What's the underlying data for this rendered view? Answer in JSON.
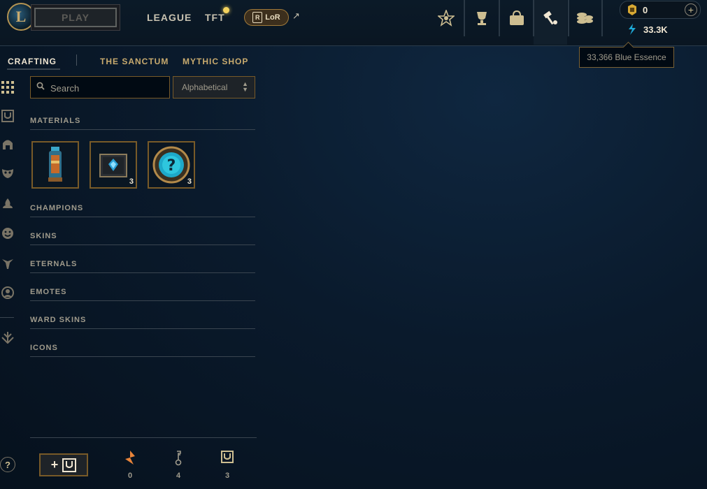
{
  "topbar": {
    "logo_letter": "L",
    "play_label": "PLAY",
    "nav": [
      "LEAGUE",
      "TFT"
    ],
    "lor_label": "LoR",
    "lor_badge": "R",
    "ext_arrow": "↗",
    "icons": [
      "rank-crest-icon",
      "trophy-icon",
      "store-bag-icon",
      "crafting-hammer-icon",
      "loot-coins-icon"
    ],
    "wallet": {
      "rp_value": "0",
      "be_value": "33.3K",
      "plus": "+"
    }
  },
  "tooltip": "33,366 Blue Essence",
  "subnav": {
    "crafting": "CRAFTING",
    "sanctum": "THE SANCTUM",
    "mythic": "MYTHIC SHOP"
  },
  "search": {
    "placeholder": "Search"
  },
  "sort": {
    "selected": "Alphabetical"
  },
  "sections": {
    "materials": "MATERIALS",
    "champions": "CHAMPIONS",
    "skins": "SKINS",
    "eternals": "ETERNALS",
    "emotes": "EMOTES",
    "ward_skins": "WARD SKINS",
    "icons": "ICONS"
  },
  "materials": [
    {
      "name": "lantern-material",
      "count": ""
    },
    {
      "name": "chest-material",
      "count": "3"
    },
    {
      "name": "mystery-orb-material",
      "count": "3"
    }
  ],
  "bottom": {
    "help": "?",
    "add_plus": "+",
    "resources": [
      {
        "icon": "orange-essence-icon",
        "count": "0",
        "color": "#e8843a"
      },
      {
        "icon": "key-fragment-icon",
        "count": "4",
        "color": "#a09b8c"
      },
      {
        "icon": "chest-icon",
        "count": "3",
        "color": "#cdbe91"
      }
    ]
  },
  "colors": {
    "gold": "#c8aa6e",
    "blue_essence": "#1ea9d6",
    "border": "#785a28"
  }
}
